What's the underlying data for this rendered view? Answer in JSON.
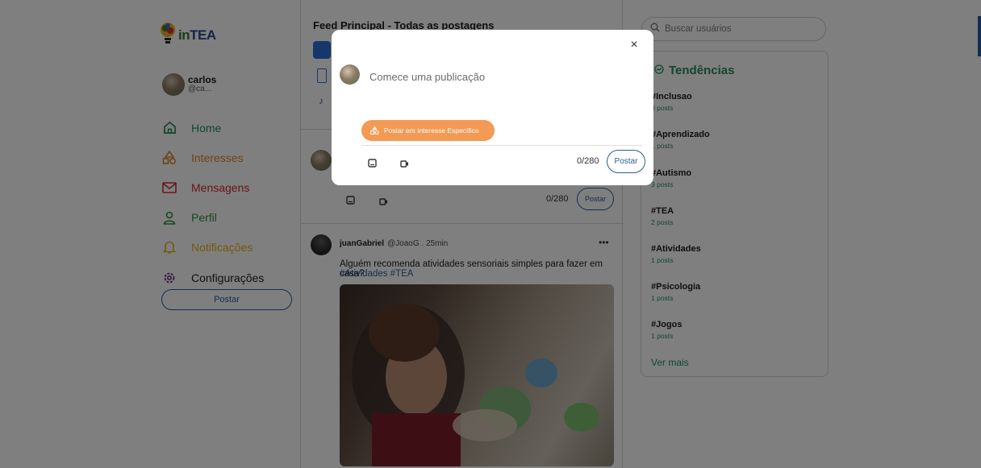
{
  "app": {
    "logo_text_a": "in",
    "logo_text_b": "TEA"
  },
  "user": {
    "name": "carlos",
    "handle": "@ca..."
  },
  "nav": [
    {
      "label": "Home",
      "icon": "home-icon"
    },
    {
      "label": "Interesses",
      "icon": "interests-shapes-icon"
    },
    {
      "label": "Mensagens",
      "icon": "mail-icon"
    },
    {
      "label": "Perfil",
      "icon": "user-icon"
    },
    {
      "label": "Notificações",
      "icon": "bell-icon"
    },
    {
      "label": "Configurações",
      "icon": "gear-icon"
    }
  ],
  "sidebar": {
    "post_button": "Postar"
  },
  "feed": {
    "title": "Feed Principal - Todas as postagens",
    "composer": {
      "count": "0/280",
      "post_button": "Postar"
    },
    "post": {
      "author": "juanGabriel",
      "handle": "@JoaoG . 25min",
      "more": "•••",
      "text": "Alguém recomenda atividades sensoriais simples para fazer em casa?",
      "tags": [
        "#Atividades",
        "#TEA"
      ]
    }
  },
  "search": {
    "placeholder": "Buscar usuários"
  },
  "trends": {
    "title": "Tendências",
    "items": [
      {
        "tag": "#Inclusao",
        "count": "3 posts"
      },
      {
        "tag": "#Aprendizado",
        "count": "1 posts"
      },
      {
        "tag": "#Autismo",
        "count": "3 posts"
      },
      {
        "tag": "#TEA",
        "count": "2 posts"
      },
      {
        "tag": "#Atividades",
        "count": "1 posts"
      },
      {
        "tag": "#Psicologia",
        "count": "1 posts"
      },
      {
        "tag": "#Jogos",
        "count": "1 posts"
      }
    ],
    "more": "Ver mais"
  },
  "modal": {
    "close": "×",
    "placeholder": "Comece uma publicação",
    "interest_button": "Postar em Interesse Específico",
    "count": "0/280",
    "post_button": "Postar"
  },
  "colors": {
    "brand_blue": "#2b5d96",
    "green": "#2a8a5c",
    "orange": "#f39a55",
    "overlay": "rgba(0,0,0,0.5)"
  }
}
